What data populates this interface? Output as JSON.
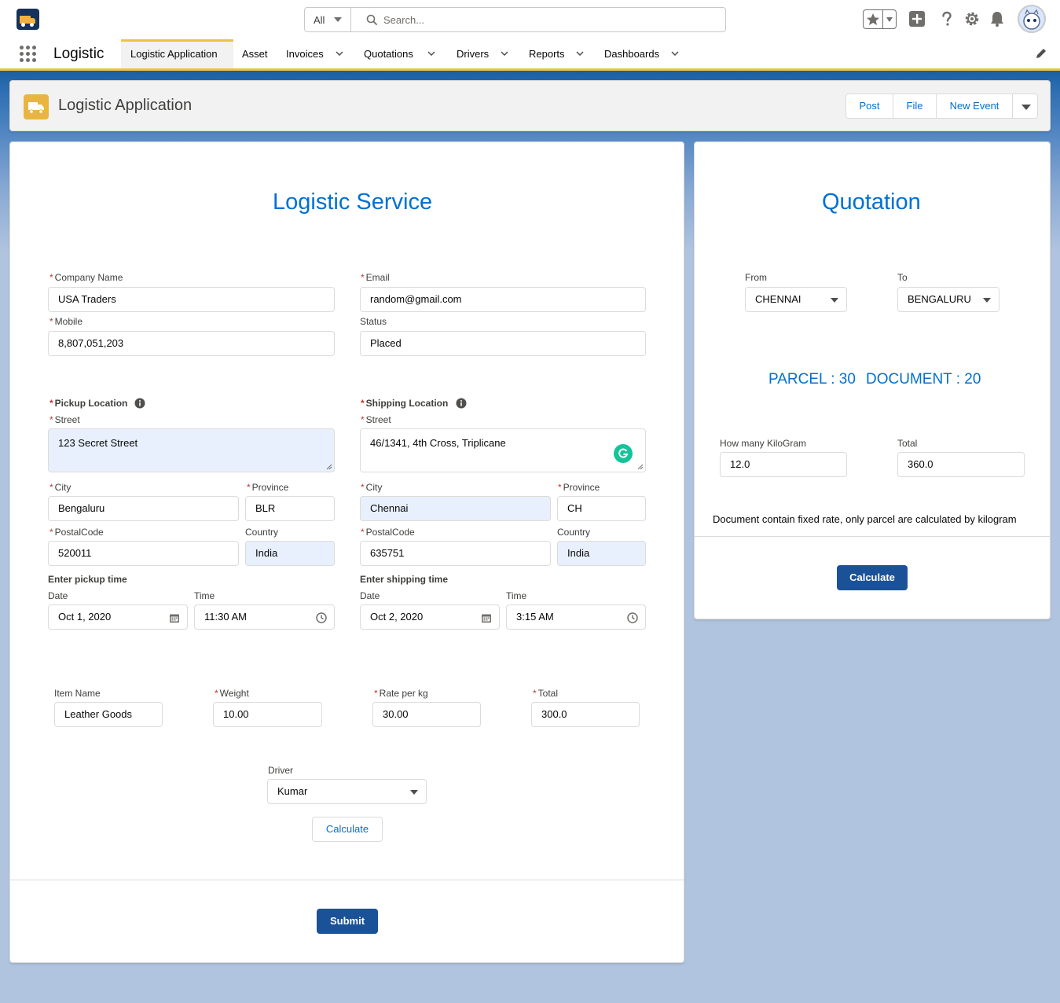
{
  "global_header": {
    "search": {
      "scope": "All",
      "placeholder": "Search..."
    }
  },
  "nav": {
    "app_name": "Logistic",
    "tabs": [
      {
        "label": "Logistic Application",
        "active": true,
        "has_menu": false
      },
      {
        "label": "Asset",
        "active": false,
        "has_menu": false
      },
      {
        "label": "Invoices",
        "active": false,
        "has_menu": true
      },
      {
        "label": "Quotations",
        "active": false,
        "has_menu": true
      },
      {
        "label": "Drivers",
        "active": false,
        "has_menu": true
      },
      {
        "label": "Reports",
        "active": false,
        "has_menu": true
      },
      {
        "label": "Dashboards",
        "active": false,
        "has_menu": true
      }
    ]
  },
  "page_header": {
    "title": "Logistic Application",
    "actions": [
      "Post",
      "File",
      "New Event"
    ]
  },
  "logistic": {
    "title": "Logistic Service",
    "company_name": {
      "label": "Company Name",
      "value": "USA Traders"
    },
    "email": {
      "label": "Email",
      "value": "random@gmail.com"
    },
    "mobile": {
      "label": "Mobile",
      "value": "8,807,051,203"
    },
    "status": {
      "label": "Status",
      "value": "Placed"
    },
    "pickup": {
      "heading": "Pickup Location",
      "street_label": "Street",
      "street": "123 Secret Street",
      "city_label": "City",
      "city": "Bengaluru",
      "province_label": "Province",
      "province": "BLR",
      "postal_label": "PostalCode",
      "postal": "520011",
      "country_label": "Country",
      "country": "India"
    },
    "shipping": {
      "heading": "Shipping Location",
      "street_label": "Street",
      "street": "46/1341, 4th Cross, Triplicane",
      "city_label": "City",
      "city": "Chennai",
      "province_label": "Province",
      "province": "CH",
      "postal_label": "PostalCode",
      "postal": "635751",
      "country_label": "Country",
      "country": "India"
    },
    "pickup_time": {
      "heading": "Enter pickup time",
      "date_label": "Date",
      "date": "Oct 1, 2020",
      "time_label": "Time",
      "time": "11:30 AM"
    },
    "shipping_time": {
      "heading": "Enter shipping time",
      "date_label": "Date",
      "date": "Oct 2, 2020",
      "time_label": "Time",
      "time": "3:15 AM"
    },
    "item_name": {
      "label": "Item Name",
      "value": "Leather Goods"
    },
    "weight": {
      "label": "Weight",
      "value": "10.00"
    },
    "rate": {
      "label": "Rate per kg",
      "value": "30.00"
    },
    "total": {
      "label": "Total",
      "value": "300.0"
    },
    "driver": {
      "label": "Driver",
      "value": "Kumar"
    },
    "calculate_label": "Calculate",
    "submit_label": "Submit"
  },
  "quotation": {
    "title": "Quotation",
    "from": {
      "label": "From",
      "value": "CHENNAI"
    },
    "to": {
      "label": "To",
      "value": "BENGALURU"
    },
    "parcel_rate": "PARCEL : 30",
    "document_rate": "DOCUMENT : 20",
    "kilogram": {
      "label": "How many KiloGram",
      "value": "12.0"
    },
    "total": {
      "label": "Total",
      "value": "360.0"
    },
    "note": "Document contain fixed rate, only parcel are calculated by kilogram",
    "calculate_label": "Calculate"
  },
  "colors": {
    "brand": "#1b5297",
    "link": "#0070d2",
    "accent_yellow": "#e8c547",
    "page_background": "#b0c4df",
    "autofill_highlight": "#e8f0fe",
    "required": "#c23934"
  },
  "icons": [
    "app-logo-truck-icon",
    "search-icon",
    "star-icon",
    "plus-icon",
    "help-icon",
    "gear-icon",
    "bell-icon",
    "avatar",
    "waffle-icon",
    "chevron-down-icon",
    "pencil-icon",
    "truck-icon",
    "info-icon",
    "calendar-icon",
    "clock-icon",
    "grammarly-icon"
  ]
}
